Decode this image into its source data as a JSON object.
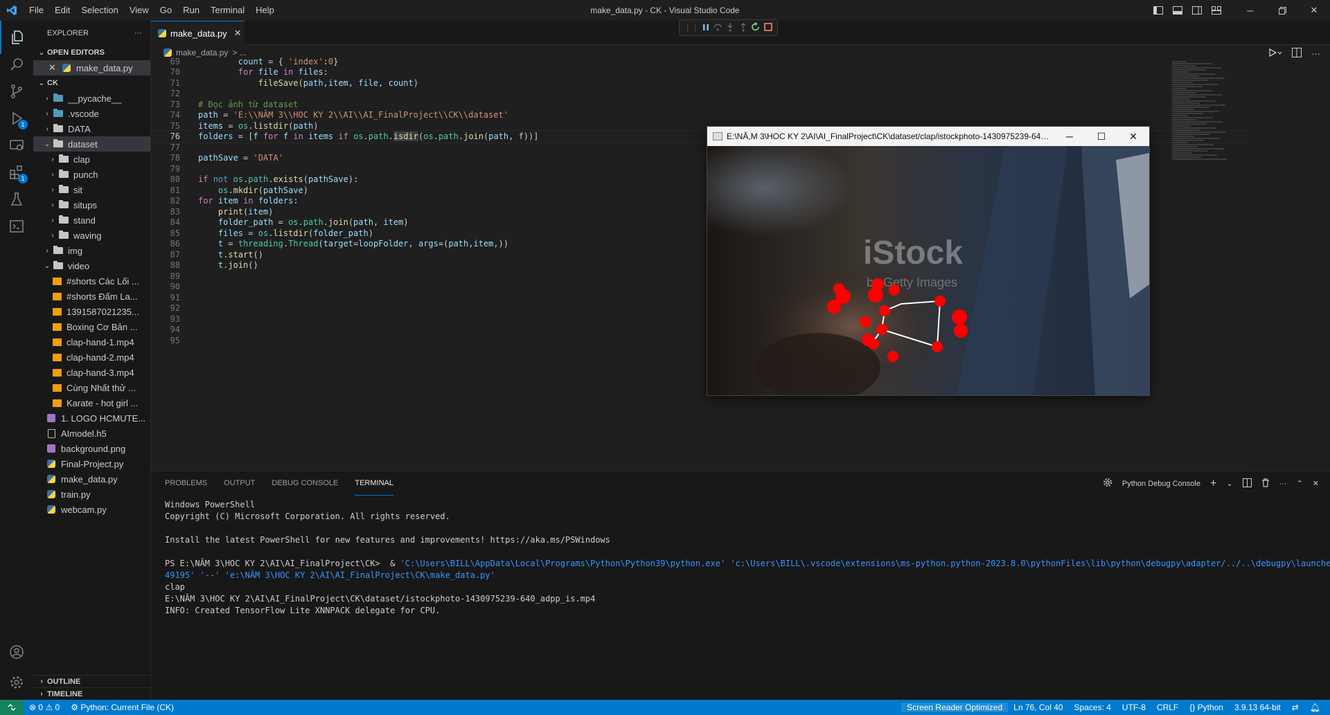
{
  "titlebar": {
    "menu": [
      "File",
      "Edit",
      "Selection",
      "View",
      "Go",
      "Run",
      "Terminal",
      "Help"
    ],
    "title": "make_data.py - CK - Visual Studio Code"
  },
  "explorer": {
    "header": "EXPLORER",
    "open_editors_label": "OPEN EDITORS",
    "open_editor_file": "make_data.py",
    "root_label": "CK",
    "tree": [
      {
        "label": "__pycache__",
        "type": "folder-blue",
        "depth": 1,
        "chev": "right"
      },
      {
        "label": ".vscode",
        "type": "folder-blue",
        "depth": 1,
        "chev": "right"
      },
      {
        "label": "DATA",
        "type": "folder",
        "depth": 1,
        "chev": "right"
      },
      {
        "label": "dataset",
        "type": "folder",
        "depth": 1,
        "chev": "down",
        "selected": true
      },
      {
        "label": "clap",
        "type": "folder",
        "depth": 2,
        "chev": "right"
      },
      {
        "label": "punch",
        "type": "folder",
        "depth": 2,
        "chev": "right"
      },
      {
        "label": "sit",
        "type": "folder",
        "depth": 2,
        "chev": "right"
      },
      {
        "label": "situps",
        "type": "folder",
        "depth": 2,
        "chev": "right"
      },
      {
        "label": "stand",
        "type": "folder",
        "depth": 2,
        "chev": "right"
      },
      {
        "label": "waving",
        "type": "folder",
        "depth": 2,
        "chev": "right"
      },
      {
        "label": "img",
        "type": "folder",
        "depth": 1,
        "chev": "right"
      },
      {
        "label": "video",
        "type": "folder",
        "depth": 1,
        "chev": "down"
      },
      {
        "label": "#shorts Các Lối ...",
        "type": "video",
        "depth": 2
      },
      {
        "label": "#shorts Đấm La...",
        "type": "video",
        "depth": 2
      },
      {
        "label": "1391587021235...",
        "type": "video",
        "depth": 2
      },
      {
        "label": "Boxing Cơ Bản ...",
        "type": "video",
        "depth": 2
      },
      {
        "label": "clap-hand-1.mp4",
        "type": "video",
        "depth": 2
      },
      {
        "label": "clap-hand-2.mp4",
        "type": "video",
        "depth": 2
      },
      {
        "label": "clap-hand-3.mp4",
        "type": "video",
        "depth": 2
      },
      {
        "label": "Cùng Nhất thử ...",
        "type": "video",
        "depth": 2
      },
      {
        "label": "Karate - hot girl ...",
        "type": "video",
        "depth": 2
      },
      {
        "label": "1. LOGO HCMUTE...",
        "type": "image",
        "depth": 1
      },
      {
        "label": "AImodel.h5",
        "type": "h5",
        "depth": 1
      },
      {
        "label": "background.png",
        "type": "image",
        "depth": 1
      },
      {
        "label": "Final-Project.py",
        "type": "python",
        "depth": 1
      },
      {
        "label": "make_data.py",
        "type": "python",
        "depth": 1
      },
      {
        "label": "train.py",
        "type": "python",
        "depth": 1
      },
      {
        "label": "webcam.py",
        "type": "python",
        "depth": 1
      }
    ],
    "outline_label": "OUTLINE",
    "timeline_label": "TIMELINE"
  },
  "editor": {
    "tab_label": "make_data.py",
    "breadcrumb_file": "make_data.py",
    "breadcrumb_rest": "> ...",
    "lines": [
      {
        "n": "69",
        "html": "        <span class=\"v\">count</span> = { <span class=\"s\">'index'</span>:<span class=\"s\">0</span>}"
      },
      {
        "n": "70",
        "html": "        <span class=\"k\">for</span> <span class=\"v\">file</span> <span class=\"k\">in</span> <span class=\"v\">files</span>:"
      },
      {
        "n": "71",
        "html": "            <span class=\"f\">fileSave</span>(<span class=\"v\">path</span>,<span class=\"v\">item</span>, <span class=\"v\">file</span>, <span class=\"v\">count</span>)"
      },
      {
        "n": "72",
        "html": ""
      },
      {
        "n": "73",
        "html": "<span class=\"c\"># Đọc ảnh từ dataset</span>"
      },
      {
        "n": "74",
        "html": "<span class=\"v\">path</span> = <span class=\"s\">'E:\\\\NĂM 3\\\\HOC KY 2\\\\AI\\\\AI_FinalProject\\\\CK\\\\dataset'</span>"
      },
      {
        "n": "75",
        "html": "<span class=\"v\">items</span> = <span class=\"t\">os</span>.<span class=\"f\">listdir</span>(<span class=\"v\">path</span>)"
      },
      {
        "n": "76",
        "html": "<span class=\"v\">folders</span> = [<span class=\"v\">f</span> <span class=\"k\">for</span> <span class=\"v\">f</span> <span class=\"k\">in</span> <span class=\"v\">items</span> <span class=\"k\">if</span> <span class=\"t\">os</span>.<span class=\"t\">path</span>.<span class=\"f\" style=\"background:#3a3d41\">isdir</span>(<span class=\"t\">os</span>.<span class=\"t\">path</span>.<span class=\"f\">join</span>(<span class=\"v\">path</span>, <span class=\"v\">f</span>))]",
        "current": true
      },
      {
        "n": "77",
        "html": ""
      },
      {
        "n": "78",
        "html": "<span class=\"v\">pathSave</span> = <span class=\"s\">'DATA'</span>"
      },
      {
        "n": "79",
        "html": ""
      },
      {
        "n": "80",
        "html": "<span class=\"k\">if</span> <span class=\"kb\">not</span> <span class=\"t\">os</span>.<span class=\"t\">path</span>.<span class=\"f\">exists</span>(<span class=\"v\">pathSave</span>):"
      },
      {
        "n": "81",
        "html": "    <span class=\"t\">os</span>.<span class=\"f\">mkdir</span>(<span class=\"v\">pathSave</span>)"
      },
      {
        "n": "82",
        "html": "<span class=\"k\">for</span> <span class=\"v\">item</span> <span class=\"k\">in</span> <span class=\"v\">folders</span>:"
      },
      {
        "n": "83",
        "html": "    <span class=\"f\">print</span>(<span class=\"v\">item</span>)"
      },
      {
        "n": "84",
        "html": "    <span class=\"v\">folder_path</span> = <span class=\"t\">os</span>.<span class=\"t\">path</span>.<span class=\"f\">join</span>(<span class=\"v\">path</span>, <span class=\"v\">item</span>)"
      },
      {
        "n": "85",
        "html": "    <span class=\"v\">files</span> = <span class=\"t\">os</span>.<span class=\"f\">listdir</span>(<span class=\"v\">folder_path</span>)"
      },
      {
        "n": "86",
        "html": "    <span class=\"v\">t</span> = <span class=\"t\">threading</span>.<span class=\"t\">Thread</span>(<span class=\"v\">target</span>=<span class=\"v\">loopFolder</span>, <span class=\"v\">args</span>=(<span class=\"v\">path</span>,<span class=\"v\">item</span>,))"
      },
      {
        "n": "87",
        "html": "    <span class=\"v\">t</span>.<span class=\"f\">start</span>()"
      },
      {
        "n": "88",
        "html": "    <span class=\"v\">t</span>.<span class=\"f\">join</span>()"
      },
      {
        "n": "89",
        "html": ""
      },
      {
        "n": "90",
        "html": ""
      },
      {
        "n": "91",
        "html": ""
      },
      {
        "n": "92",
        "html": ""
      },
      {
        "n": "93",
        "html": ""
      },
      {
        "n": "94",
        "html": ""
      },
      {
        "n": "95",
        "html": ""
      }
    ]
  },
  "image_window": {
    "title": "E:\\NĂ,M 3\\HOC KY 2\\AI\\AI_FinalProject\\CK\\dataset/clap/istockphoto-1430975239-640_...",
    "watermark": "iStock",
    "watermark_sub": "by Getty Images"
  },
  "panel": {
    "tabs": [
      "PROBLEMS",
      "OUTPUT",
      "DEBUG CONSOLE",
      "TERMINAL"
    ],
    "active_tab": "TERMINAL",
    "console_label": "Python Debug Console",
    "terminal": [
      {
        "text": "Windows PowerShell"
      },
      {
        "text": "Copyright (C) Microsoft Corporation. All rights reserved."
      },
      {
        "text": ""
      },
      {
        "text": "Install the latest PowerShell for new features and improvements! https://aka.ms/PSWindows"
      },
      {
        "text": ""
      },
      {
        "text": "PS E:\\NĂM 3\\HOC KY 2\\AI\\AI_FinalProject\\CK>  & ",
        "cmd": "'C:\\Users\\BILL\\AppData\\Local\\Programs\\Python\\Python39\\python.exe' 'c:\\Users\\BILL\\.vscode\\extensions\\ms-python.python-2023.8.0\\pythonFiles\\lib\\python\\debugpy\\adapter/../..\\debugpy\\launcher' '"
      },
      {
        "text": "",
        "cmd": "49195' '--' 'e:\\NĂM 3\\HOC KY 2\\AI\\AI_FinalProject\\CK\\make_data.py'"
      },
      {
        "text": "clap"
      },
      {
        "text": "E:\\NĂM 3\\HOC KY 2\\AI\\AI_FinalProject\\CK\\dataset/istockphoto-1430975239-640_adpp_is.mp4"
      },
      {
        "text": "INFO: Created TensorFlow Lite XNNPACK delegate for CPU."
      }
    ]
  },
  "statusbar": {
    "errors": "0",
    "warnings": "0",
    "run_config": "Python: Current File (CK)",
    "screen_reader": "Screen Reader Optimized",
    "position": "Ln 76, Col 40",
    "spaces": "Spaces: 4",
    "encoding": "UTF-8",
    "eol": "CRLF",
    "language": "Python",
    "interpreter": "3.9.13 64-bit"
  },
  "colors": {
    "accent": "#0078d4",
    "statusbar": "#007acc",
    "landmark": "#ff0000"
  }
}
